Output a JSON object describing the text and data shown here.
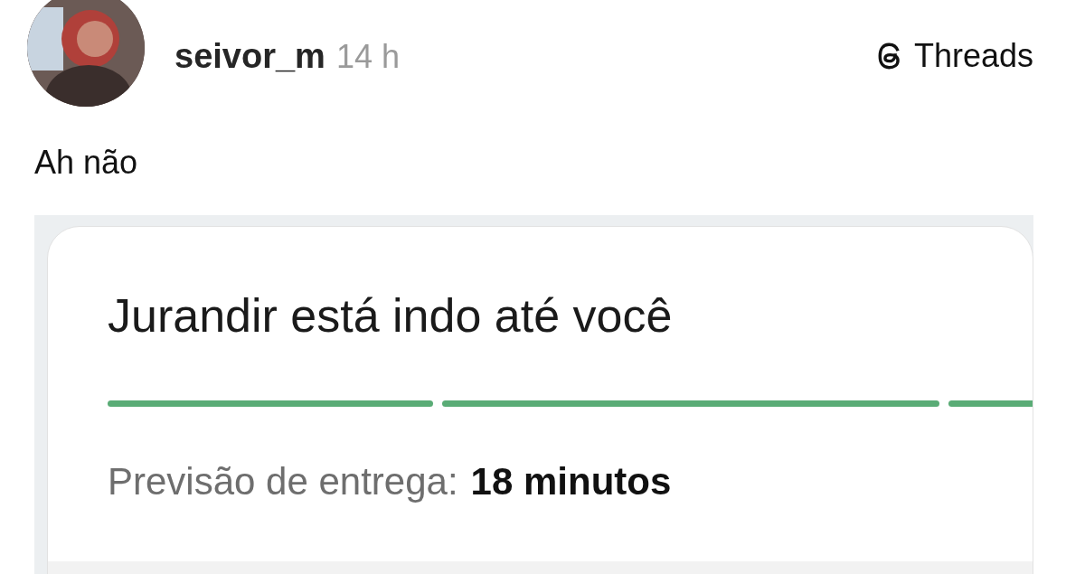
{
  "post": {
    "username": "seivor_m",
    "time": "14 h",
    "brand": "Threads",
    "text": "Ah não"
  },
  "embedded": {
    "title": "Jurandir está indo até você",
    "eta_label": "Previsão de entrega:",
    "eta_value": "18 minutos"
  }
}
